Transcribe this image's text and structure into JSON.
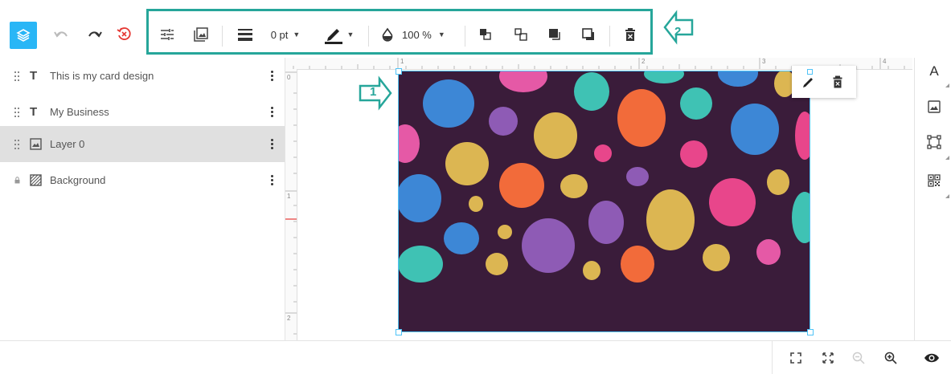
{
  "toolbar": {
    "items": [
      {
        "name": "layers-button",
        "icon": "layers-icon"
      },
      {
        "name": "undo-button",
        "icon": "undo-icon"
      },
      {
        "name": "redo-button",
        "icon": "redo-icon"
      },
      {
        "name": "reset-button",
        "icon": "reset-history-icon"
      },
      {
        "name": "adjustments-button",
        "icon": "sliders-icon"
      },
      {
        "name": "image-replace-button",
        "icon": "image-icon"
      },
      {
        "name": "border-style-button",
        "icon": "lines-icon"
      },
      {
        "name": "line-color-button",
        "icon": "pen-icon"
      },
      {
        "name": "opacity-icon",
        "icon": "droplet-icon"
      },
      {
        "name": "bring-forward-button",
        "icon": "arrange-forward-icon"
      },
      {
        "name": "send-backward-button",
        "icon": "arrange-backward-icon"
      },
      {
        "name": "bring-to-front-button",
        "icon": "front-icon"
      },
      {
        "name": "send-to-back-button",
        "icon": "back-icon"
      },
      {
        "name": "delete-button",
        "icon": "trash-icon"
      }
    ],
    "border_width": "0 pt",
    "opacity": "100 %",
    "accent": "#29b6f6",
    "highlight_color": "#26a69a"
  },
  "layers": [
    {
      "label": "This is my card design",
      "type": "text",
      "icon": "text-icon",
      "selected": false
    },
    {
      "label": "My Business",
      "type": "text",
      "icon": "text-icon",
      "selected": false
    },
    {
      "label": "Layer 0",
      "type": "image",
      "icon": "image-icon",
      "selected": true
    },
    {
      "label": "Background",
      "type": "background",
      "icon": "background-icon",
      "locked": true,
      "selected": false
    }
  ],
  "ruler": {
    "h_labels": [
      "1",
      "2",
      "3",
      "4"
    ],
    "v_labels": [
      "0",
      "1",
      "2"
    ]
  },
  "callouts": {
    "one": "1",
    "two": "2"
  },
  "canvas": {
    "background": "#3a1c3a"
  },
  "context_popup": {
    "items": [
      "pen-icon",
      "trash-icon"
    ]
  },
  "right_panel": {
    "items": [
      {
        "name": "add-text-button",
        "icon": "text-a-icon"
      },
      {
        "name": "add-image-button",
        "icon": "image-icon"
      },
      {
        "name": "add-shape-button",
        "icon": "shape-frame-icon"
      },
      {
        "name": "add-qr-button",
        "icon": "qr-code-icon"
      }
    ],
    "add_text_glyph": "A"
  },
  "bottom_bar": {
    "items": [
      {
        "name": "fit-page-button",
        "icon": "fit-icon"
      },
      {
        "name": "fullscreen-button",
        "icon": "expand-icon"
      },
      {
        "name": "zoom-out-button",
        "icon": "zoom-out-icon",
        "disabled": true
      },
      {
        "name": "zoom-in-button",
        "icon": "zoom-in-icon"
      },
      {
        "name": "preview-button",
        "icon": "eye-icon"
      }
    ]
  }
}
